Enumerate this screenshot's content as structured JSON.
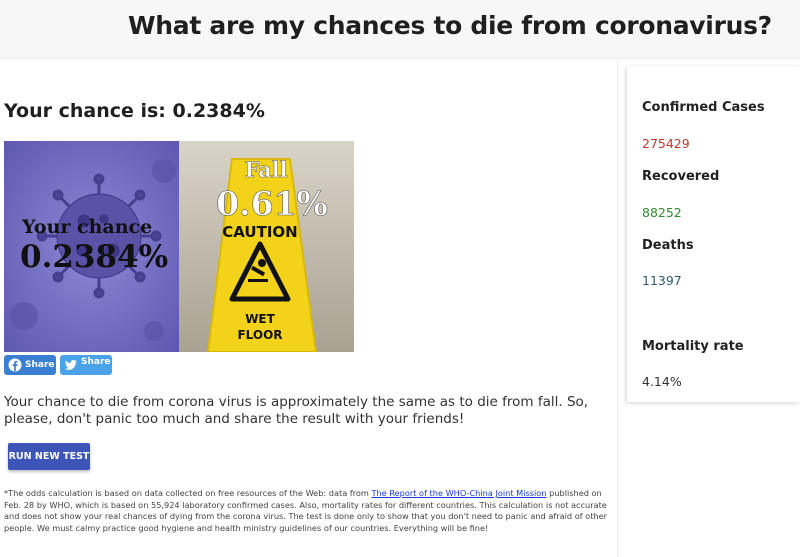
{
  "header": {
    "title": "What are my chances to die from coronavirus?"
  },
  "result": {
    "heading": "Your chance is: 0.2384%"
  },
  "hero": {
    "left_caption": "Your chance",
    "left_value": "0.2384%",
    "right_caption": "Fall",
    "right_value": "0.61%",
    "sign_title": "CAUTION",
    "sign_line1": "WET",
    "sign_line2": "FLOOR"
  },
  "share": {
    "facebook_label": "Share",
    "twitter_label": "Share"
  },
  "description": "Your chance to die from corona virus is approximately the same as to die from fall. So, please, don't panic too much and share the result with your friends!",
  "actions": {
    "run_label": "RUN NEW TEST"
  },
  "footnote": {
    "before_link": "*The odds calculation is based on data collected on free resources of the Web: data from ",
    "link_text": "The Report of the WHO-China Joint Mission",
    "after_link": " published on Feb. 28 by WHO, which is based on 55,924 laboratory confirmed cases. Also, mortality rates for different countries. This calculation is not accurate and does not show your real chances of dying from the corona virus. The test is done only to show that you don't need to panic and afraid of other people. We must calmy practice good hygiene and health ministry guidelines of our countries. Everything will be fine!"
  },
  "stats": {
    "confirmed_label": "Confirmed Cases",
    "confirmed_value": "275429",
    "recovered_label": "Recovered",
    "recovered_value": "88252",
    "deaths_label": "Deaths",
    "deaths_value": "11397",
    "mortality_label": "Mortality rate",
    "mortality_value": "4.14%"
  },
  "colors": {
    "confirmed": "#c0392b",
    "recovered": "#2e8b2e",
    "deaths": "#2c5d6e",
    "button": "#3d55b8",
    "virus_bg": "#7b74c7",
    "sign_yellow": "#f3d21a"
  }
}
